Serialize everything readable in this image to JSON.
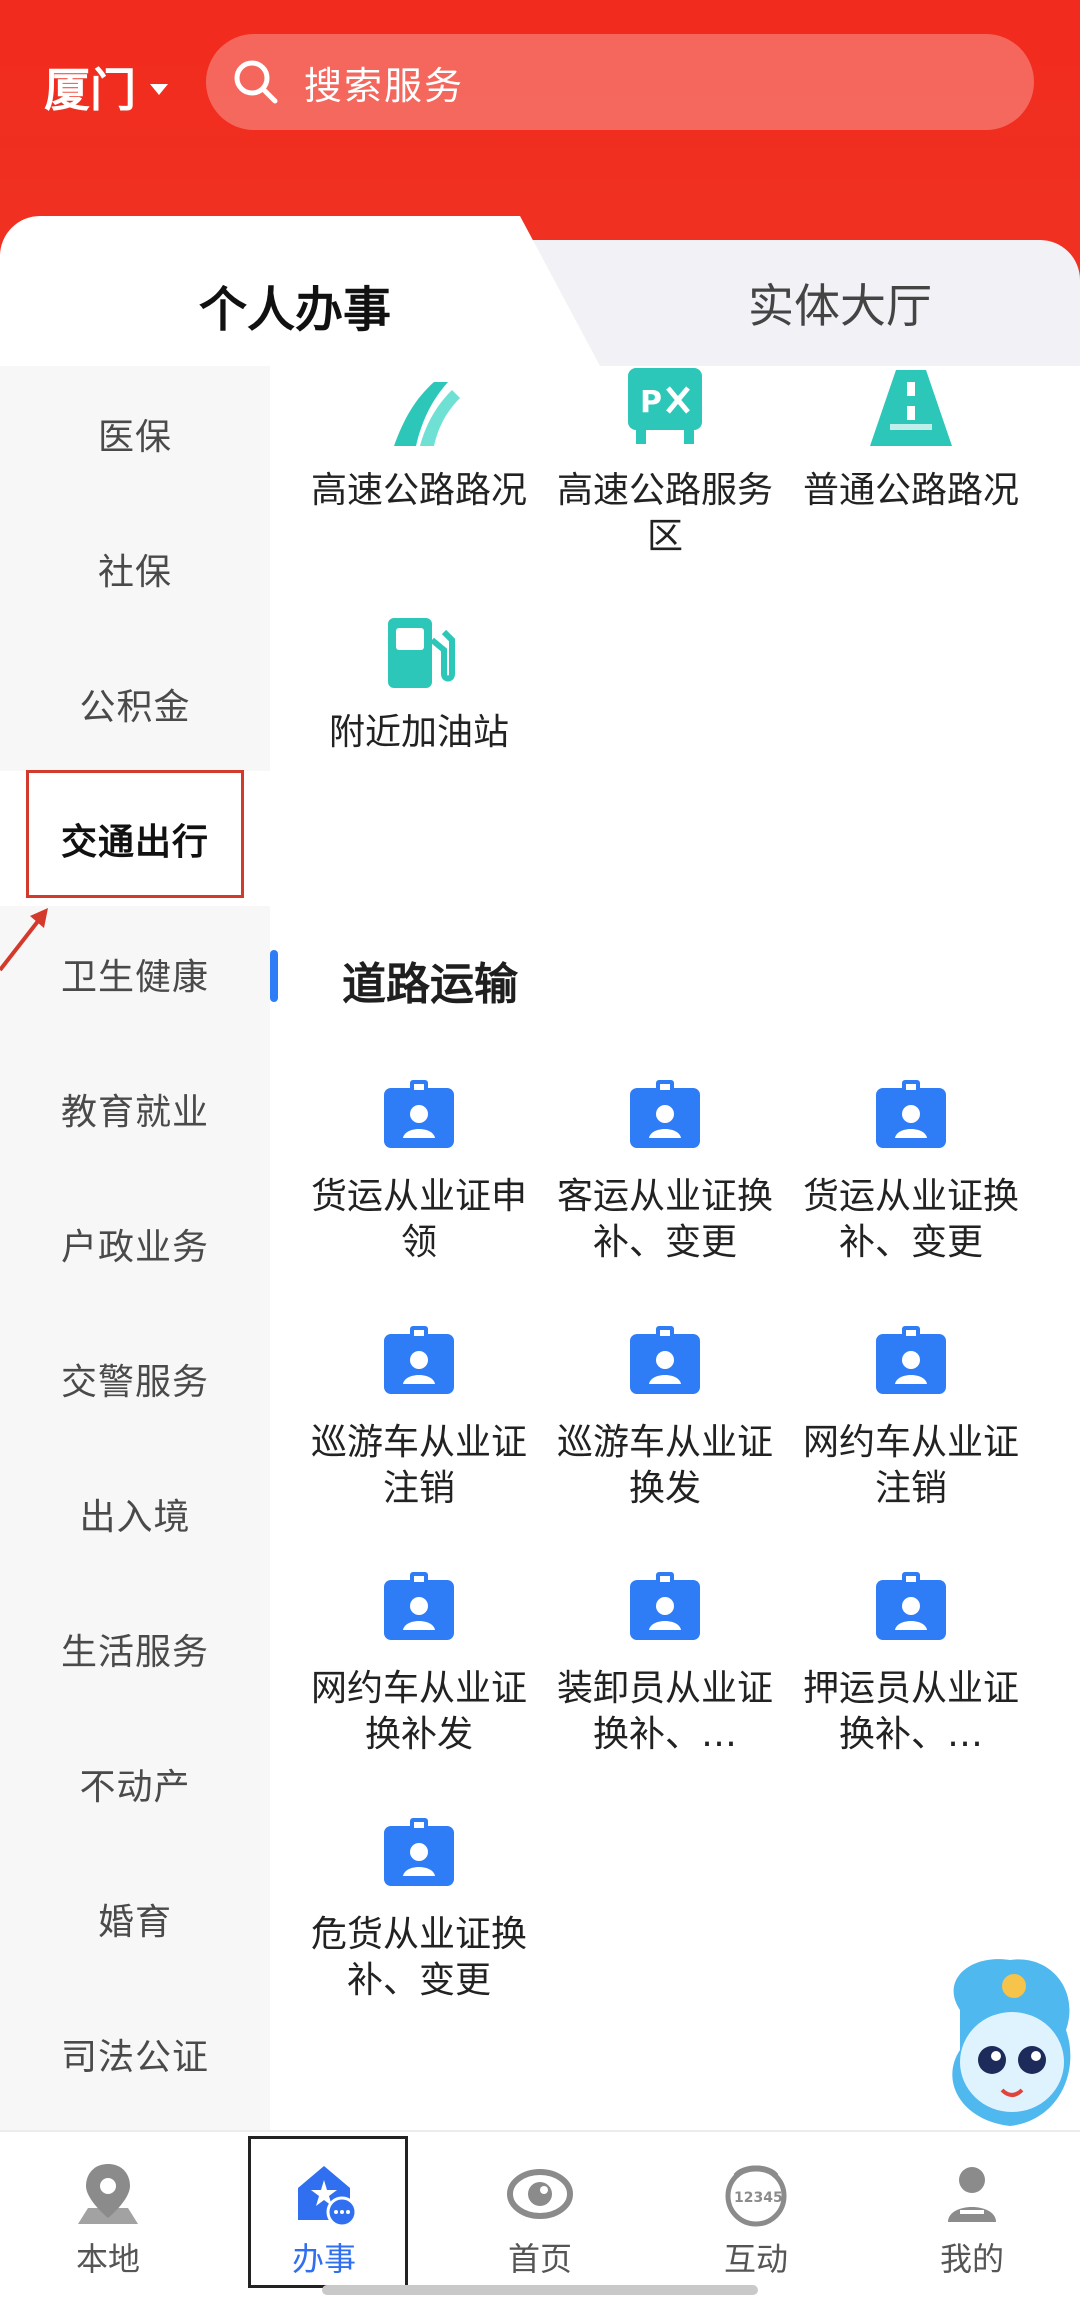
{
  "header": {
    "city": "厦门",
    "search_placeholder": "搜索服务"
  },
  "tabs": {
    "active": "个人办事",
    "inactive": "实体大厅"
  },
  "sidebar": {
    "items": [
      {
        "label": "医保"
      },
      {
        "label": "社保"
      },
      {
        "label": "公积金"
      },
      {
        "label": "交通出行"
      },
      {
        "label": "卫生健康"
      },
      {
        "label": "教育就业"
      },
      {
        "label": "户政业务"
      },
      {
        "label": "交警服务"
      },
      {
        "label": "出入境"
      },
      {
        "label": "生活服务"
      },
      {
        "label": "不动产"
      },
      {
        "label": "婚育"
      },
      {
        "label": "司法公证"
      }
    ],
    "active_index": 3
  },
  "top_services": [
    {
      "label": "高速公路路况",
      "icon": "highway-road-icon"
    },
    {
      "label": "高速公路服务区",
      "icon": "service-area-icon"
    },
    {
      "label": "普通公路路况",
      "icon": "road-icon"
    },
    {
      "label": "附近加油站",
      "icon": "gas-station-icon"
    }
  ],
  "section": {
    "title": "道路运输",
    "items": [
      {
        "label": "货运从业证申领"
      },
      {
        "label": "客运从业证换补、变更"
      },
      {
        "label": "货运从业证换补、变更"
      },
      {
        "label": "巡游车从业证注销"
      },
      {
        "label": "巡游车从业证换发"
      },
      {
        "label": "网约车从业证注销"
      },
      {
        "label": "网约车从业证换补发"
      },
      {
        "label": "装卸员从业证换补、…"
      },
      {
        "label": "押运员从业证换补、…"
      },
      {
        "label": "危货从业证换补、变更"
      }
    ]
  },
  "bottom_nav": [
    {
      "label": "本地",
      "icon": "location-icon"
    },
    {
      "label": "办事",
      "icon": "service-hall-icon",
      "active": true
    },
    {
      "label": "首页",
      "icon": "home-logo-icon"
    },
    {
      "label": "互动",
      "icon": "hotline-12345-icon",
      "badge": "12345"
    },
    {
      "label": "我的",
      "icon": "user-icon"
    }
  ],
  "colors": {
    "header_red": "#f12b1e",
    "teal_icon": "#2cc7b8",
    "blue_icon": "#2f7df6",
    "active_nav": "#2f6ff0",
    "annotation_red": "#d33a2c"
  }
}
